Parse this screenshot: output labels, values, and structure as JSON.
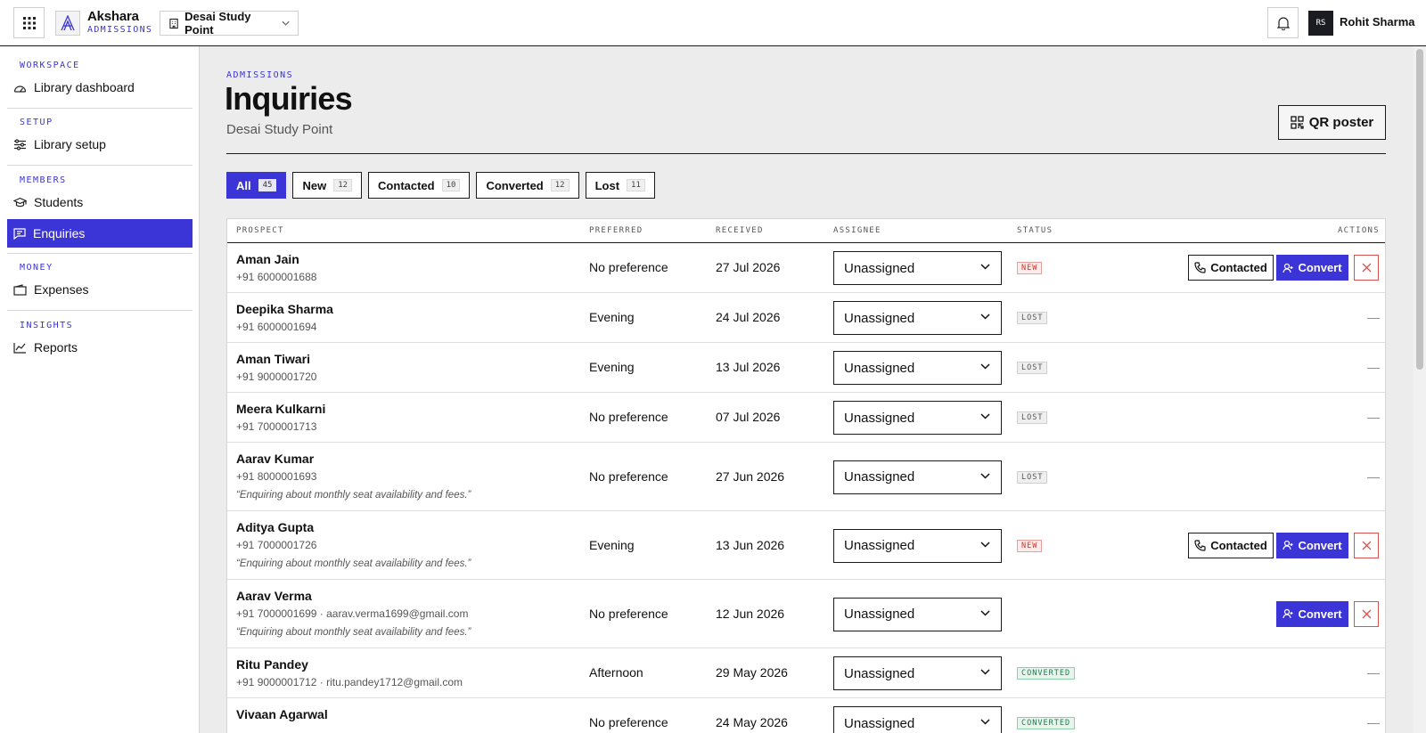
{
  "app": {
    "name": "Akshara",
    "module": "ADMISSIONS"
  },
  "branch": {
    "selected": "Desai Study Point"
  },
  "user": {
    "initials": "RS",
    "name": "Rohit Sharma"
  },
  "sidebar": {
    "sections": [
      {
        "heading": "WORKSPACE",
        "items": [
          {
            "label": "Library dashboard",
            "icon": "gauge-icon"
          }
        ]
      },
      {
        "heading": "SETUP",
        "items": [
          {
            "label": "Library setup",
            "icon": "sliders-icon"
          }
        ]
      },
      {
        "heading": "MEMBERS",
        "items": [
          {
            "label": "Students",
            "icon": "graduation-cap-icon"
          },
          {
            "label": "Enquiries",
            "icon": "message-icon",
            "active": true
          }
        ]
      },
      {
        "heading": "MONEY",
        "items": [
          {
            "label": "Expenses",
            "icon": "wallet-icon"
          }
        ]
      },
      {
        "heading": "INSIGHTS",
        "items": [
          {
            "label": "Reports",
            "icon": "line-chart-icon"
          }
        ]
      }
    ]
  },
  "page": {
    "eyebrow": "ADMISSIONS",
    "title": "Inquiries",
    "subtitle": "Desai Study Point",
    "qr_button": "QR poster"
  },
  "filters": [
    {
      "label": "All",
      "count": "45",
      "active": true
    },
    {
      "label": "New",
      "count": "12"
    },
    {
      "label": "Contacted",
      "count": "10"
    },
    {
      "label": "Converted",
      "count": "12"
    },
    {
      "label": "Lost",
      "count": "11"
    }
  ],
  "table": {
    "columns": {
      "prospect": "PROSPECT",
      "preferred": "PREFERRED",
      "received": "RECEIVED",
      "assignee": "ASSIGNEE",
      "status": "STATUS",
      "actions": "ACTIONS"
    },
    "action_labels": {
      "contacted": "Contacted",
      "convert": "Convert",
      "none": "—"
    },
    "rows": [
      {
        "name": "Aman Jain",
        "contact": "+91 6000001688",
        "note": "",
        "preferred": "No preference",
        "received": "27 Jul 2026",
        "assignee": "Unassigned",
        "status": "NEW",
        "status_kind": "new",
        "actions": "full"
      },
      {
        "name": "Deepika Sharma",
        "contact": "+91 6000001694",
        "note": "",
        "preferred": "Evening",
        "received": "24 Jul 2026",
        "assignee": "Unassigned",
        "status": "LOST",
        "status_kind": "lost",
        "actions": "none"
      },
      {
        "name": "Aman Tiwari",
        "contact": "+91 9000001720",
        "note": "",
        "preferred": "Evening",
        "received": "13 Jul 2026",
        "assignee": "Unassigned",
        "status": "LOST",
        "status_kind": "lost",
        "actions": "none"
      },
      {
        "name": "Meera Kulkarni",
        "contact": "+91 7000001713",
        "note": "",
        "preferred": "No preference",
        "received": "07 Jul 2026",
        "assignee": "Unassigned",
        "status": "LOST",
        "status_kind": "lost",
        "actions": "none"
      },
      {
        "name": "Aarav Kumar",
        "contact": "+91 8000001693",
        "note": "“Enquiring about monthly seat availability and fees.”",
        "preferred": "No preference",
        "received": "27 Jun 2026",
        "assignee": "Unassigned",
        "status": "LOST",
        "status_kind": "lost",
        "actions": "none"
      },
      {
        "name": "Aditya Gupta",
        "contact": "+91 7000001726",
        "note": "“Enquiring about monthly seat availability and fees.”",
        "preferred": "Evening",
        "received": "13 Jun 2026",
        "assignee": "Unassigned",
        "status": "NEW",
        "status_kind": "new",
        "actions": "full"
      },
      {
        "name": "Aarav Verma",
        "contact": "+91 7000001699 · aarav.verma1699@gmail.com",
        "note": "“Enquiring about monthly seat availability and fees.”",
        "preferred": "No preference",
        "received": "12 Jun 2026",
        "assignee": "Unassigned",
        "status": "",
        "status_kind": "",
        "actions": "convert"
      },
      {
        "name": "Ritu Pandey",
        "contact": "+91 9000001712 · ritu.pandey1712@gmail.com",
        "note": "",
        "preferred": "Afternoon",
        "received": "29 May 2026",
        "assignee": "Unassigned",
        "status": "CONVERTED",
        "status_kind": "converted",
        "actions": "none"
      },
      {
        "name": "Vivaan Agarwal",
        "contact": "",
        "note": "",
        "preferred": "No preference",
        "received": "24 May 2026",
        "assignee": "Unassigned",
        "status": "CONVERTED",
        "status_kind": "converted",
        "actions": "none"
      }
    ]
  }
}
